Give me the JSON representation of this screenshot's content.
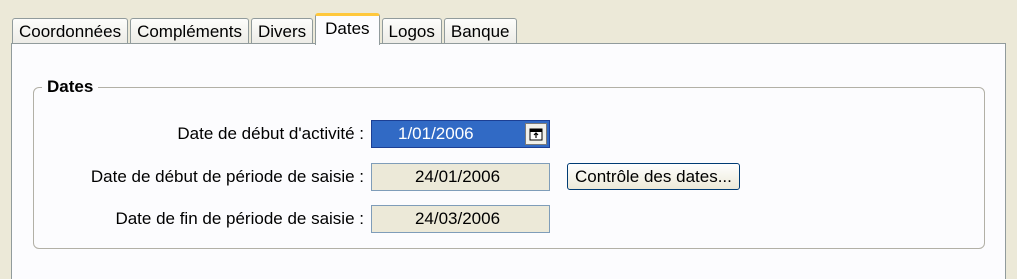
{
  "tabs": [
    {
      "label": "Coordonnées",
      "active": false
    },
    {
      "label": "Compléments",
      "active": false
    },
    {
      "label": "Divers",
      "active": false
    },
    {
      "label": "Dates",
      "active": true
    },
    {
      "label": "Logos",
      "active": false
    },
    {
      "label": "Banque",
      "active": false
    }
  ],
  "group": {
    "title": "Dates"
  },
  "fields": {
    "start_activity": {
      "label": "Date de début d'activité :",
      "value": "1/01/2006",
      "icon": "calendar-icon"
    },
    "start_period": {
      "label": "Date de début de période de saisie :",
      "value": "24/01/2006"
    },
    "end_period": {
      "label": "Date de fin de période de saisie :",
      "value": "24/03/2006"
    }
  },
  "buttons": {
    "check_dates": "Contrôle des dates..."
  },
  "colors": {
    "window_bg": "#ece9d8",
    "page_bg": "#fcfcfe",
    "selection": "#316ac5",
    "active_tab_accent": "#ffc83c"
  }
}
